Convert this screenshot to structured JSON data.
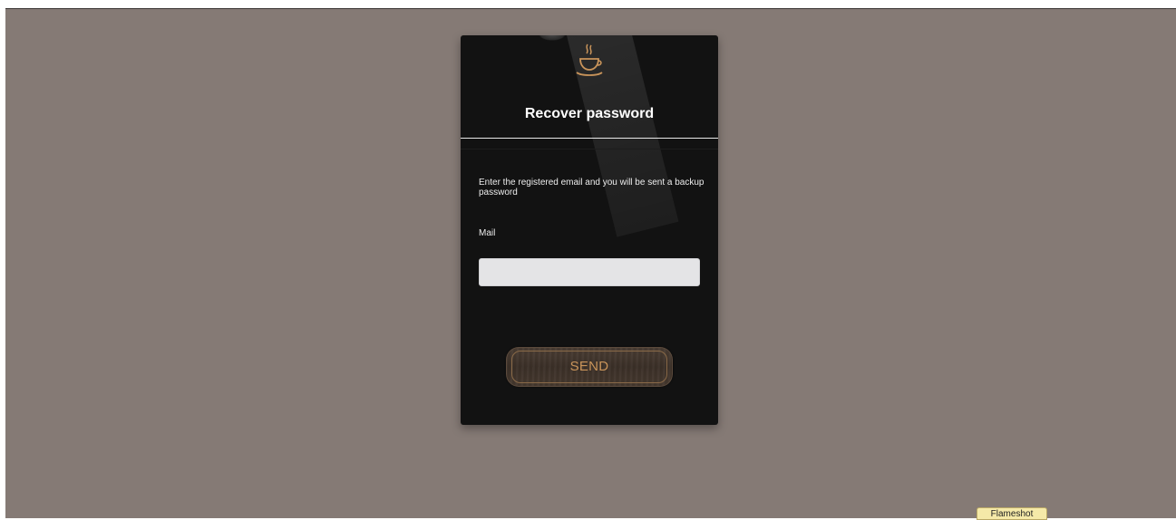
{
  "card": {
    "title": "Recover password",
    "description": "Enter the registered email and you will be sent a backup password",
    "mail_label": "Mail",
    "mail_value": "",
    "mail_placeholder": "",
    "send_label": "SEND"
  },
  "taskbar": {
    "flameshot_label": "Flameshot"
  },
  "icons": {
    "logo": "coffee-cup-icon"
  },
  "colors": {
    "background": "#857a75",
    "card": "#121212",
    "accent": "#c9945a",
    "title": "#ffffff"
  }
}
